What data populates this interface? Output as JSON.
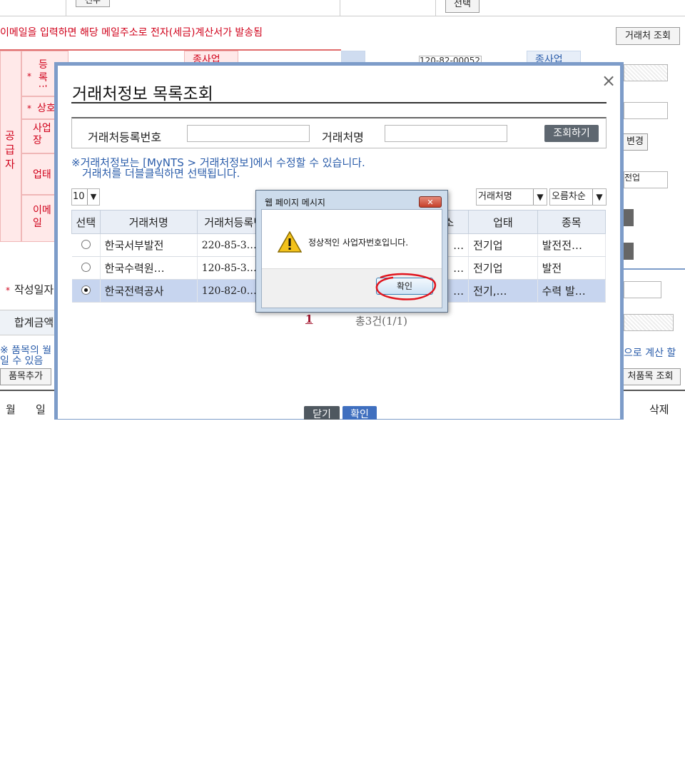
{
  "background": {
    "top_btn_1": "전주",
    "top_btn_select": "선택",
    "email_notice": "이메일을 입력하면 해당 메일주소로 전자(세금)계산서가 발송됨",
    "partner_lookup_btn": "거래처 조회",
    "supplier_vertical": "공급자",
    "row_labels": [
      "등록번호",
      "상호",
      "사업장",
      "업태",
      "이메일"
    ],
    "col_label_jong": "종사업",
    "col_label_jong2": "종사업",
    "reg_value_partial": "120-82-00052",
    "change_btn": "변경",
    "business_type_value": "전업",
    "written_date_label": "작성일자",
    "total_amount_label": "합계금액",
    "item_notice_left": "※ 품목의 월일 수 있음",
    "item_notice_right": "으로 계산 할",
    "add_item_btn": "품목추가",
    "partner_item_btn": "처품목 조회",
    "col_month": "월",
    "col_day": "일",
    "col_delete": "삭제"
  },
  "modal": {
    "title": "거래처정보 목록조회",
    "close_label": "×",
    "search": {
      "reg_label": "거래처등록번호",
      "name_label": "거래처명",
      "search_btn": "조회하기"
    },
    "notice_line1": "※거래처정보는 [MyNTS > 거래처정보]에서 수정할 수 있습니다.",
    "notice_line2": "거래처를 더블클릭하면 선택됩니다.",
    "page_size": "10",
    "sort_field": "거래처명",
    "sort_order": "오름차순",
    "columns": [
      "선택",
      "거래처명",
      "거래처등록번",
      "소",
      "업태",
      "종목"
    ],
    "rows": [
      {
        "name": "한국서부발전",
        "reg": "220-85-3…",
        "addr": "…",
        "type": "전기업",
        "item": "발전전…",
        "selected": false
      },
      {
        "name": "한국수력원…",
        "reg": "120-85-3…",
        "addr": "…",
        "type": "전기업",
        "item": "발전",
        "selected": false
      },
      {
        "name": "한국전력공사",
        "reg": "120-82-0…",
        "addr": "…",
        "type": "전기,…",
        "item": "수력 발…",
        "selected": true
      }
    ],
    "pager_current": "1",
    "pager_total": "총3건(1/1)",
    "close_btn": "닫기",
    "confirm_btn": "확인"
  },
  "dialog": {
    "title": "웹 페이지 메시지",
    "close_label": "✕",
    "message": "정상적인 사업자번호입니다.",
    "ok_btn": "확인"
  }
}
